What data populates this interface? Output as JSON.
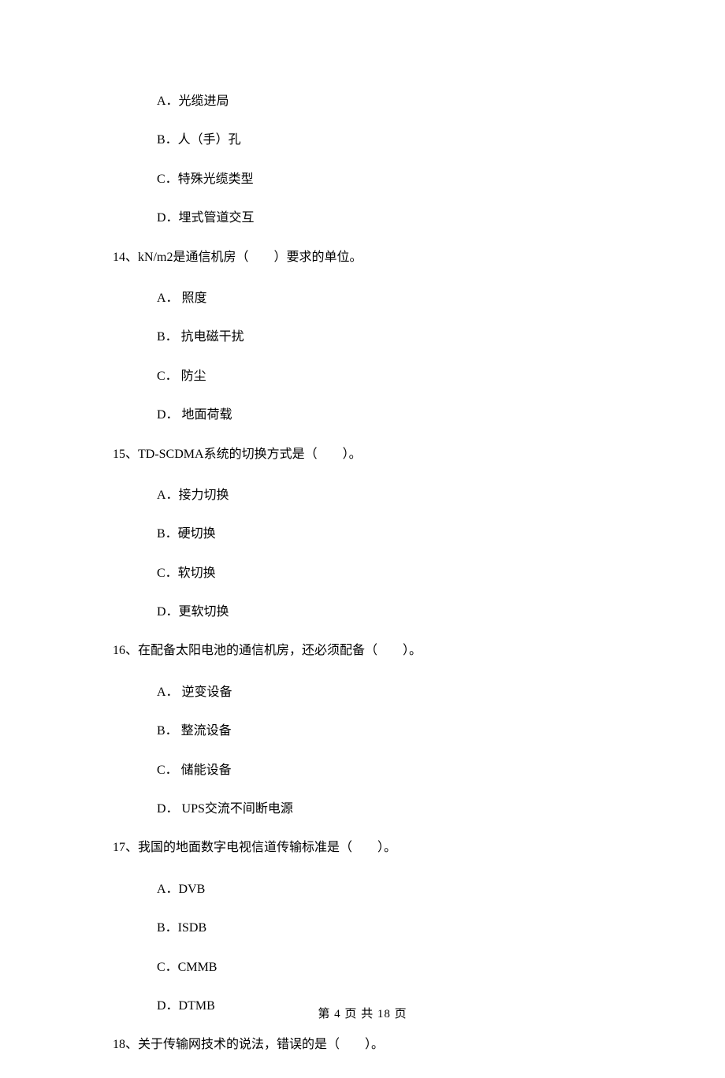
{
  "prev_question_options": {
    "A": "A．光缆进局",
    "B": "B．人（手）孔",
    "C": "C．特殊光缆类型",
    "D": "D．埋式管道交互"
  },
  "q14": {
    "stem": "14、kN/m2是通信机房（　　）要求的单位。",
    "A": "A． 照度",
    "B": "B． 抗电磁干扰",
    "C": "C． 防尘",
    "D": "D． 地面荷载"
  },
  "q15": {
    "stem": "15、TD-SCDMA系统的切换方式是（　　）。",
    "A": "A．接力切换",
    "B": "B．硬切换",
    "C": "C．软切换",
    "D": "D．更软切换"
  },
  "q16": {
    "stem": "16、在配备太阳电池的通信机房，还必须配备（　　）。",
    "A": "A． 逆变设备",
    "B": "B． 整流设备",
    "C": "C． 储能设备",
    "D": "D． UPS交流不间断电源"
  },
  "q17": {
    "stem": "17、我国的地面数字电视信道传输标准是（　　）。",
    "A": "A．DVB",
    "B": "B．ISDB",
    "C": "C．CMMB",
    "D": "D．DTMB"
  },
  "q18": {
    "stem": "18、关于传输网技术的说法，错误的是（　　）。"
  },
  "footer": "第 4 页 共 18 页"
}
